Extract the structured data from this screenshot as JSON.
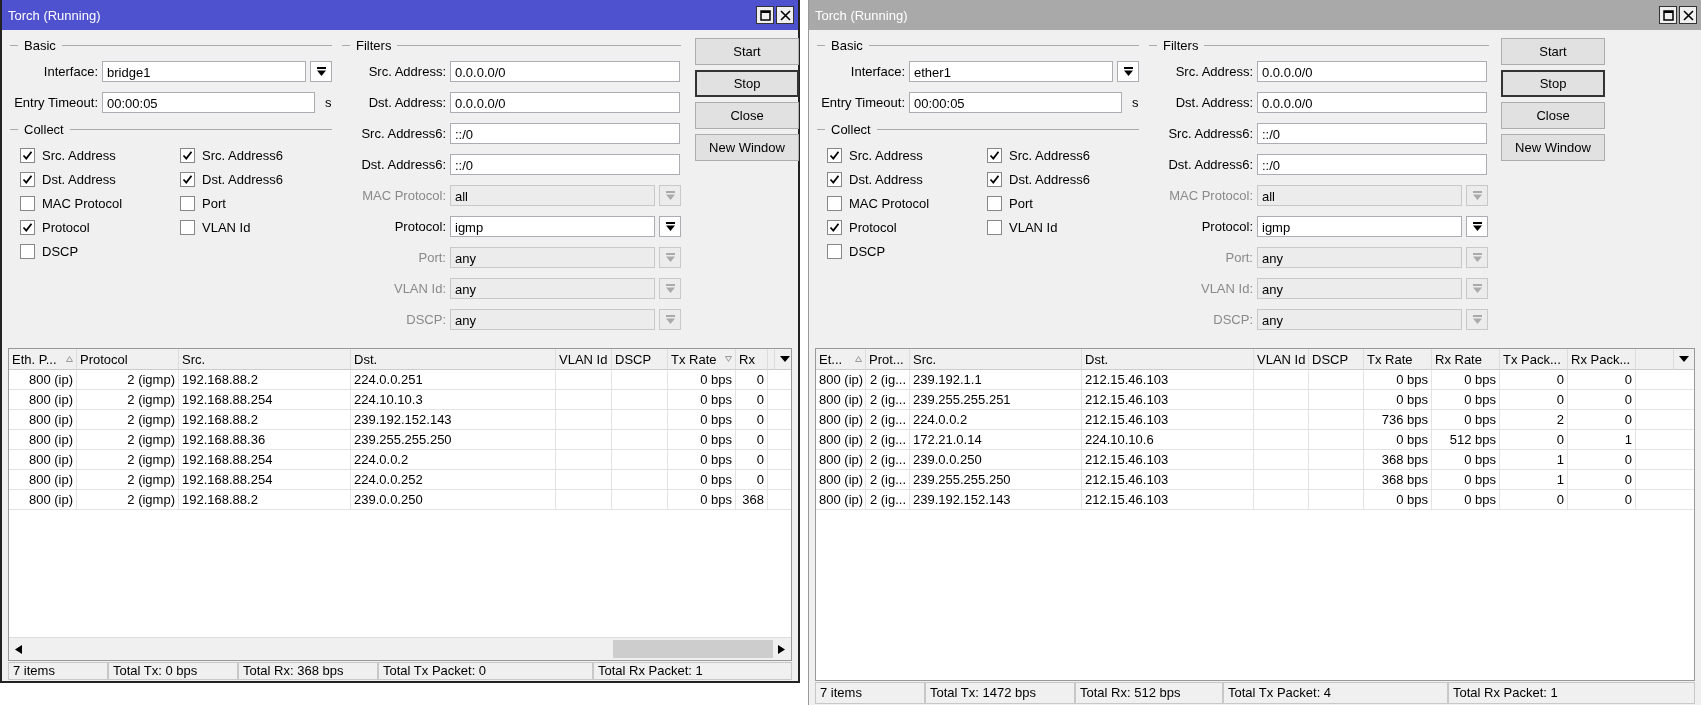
{
  "windows": [
    {
      "title": "Torch (Running)",
      "active": true,
      "horizontal_scrollbar": true,
      "basic": {
        "label": "Basic",
        "interface": {
          "label": "Interface:",
          "value": "bridge1"
        },
        "entry_timeout": {
          "label": "Entry Timeout:",
          "value": "00:00:05",
          "unit": "s"
        }
      },
      "collect": {
        "label": "Collect",
        "items": [
          {
            "label": "Src. Address",
            "checked": true
          },
          {
            "label": "Src. Address6",
            "checked": true
          },
          {
            "label": "Dst. Address",
            "checked": true
          },
          {
            "label": "Dst. Address6",
            "checked": true
          },
          {
            "label": "MAC Protocol",
            "checked": false
          },
          {
            "label": "Port",
            "checked": false
          },
          {
            "label": "Protocol",
            "checked": true
          },
          {
            "label": "VLAN Id",
            "checked": false
          },
          {
            "label": "DSCP",
            "checked": false
          }
        ]
      },
      "filters": {
        "label": "Filters",
        "fields": [
          {
            "label": "Src. Address:",
            "value": "0.0.0.0/0",
            "kind": "text",
            "disabled": false
          },
          {
            "label": "Dst. Address:",
            "value": "0.0.0.0/0",
            "kind": "text",
            "disabled": false
          },
          {
            "label": "Src. Address6:",
            "value": "::/0",
            "kind": "text",
            "disabled": false
          },
          {
            "label": "Dst. Address6:",
            "value": "::/0",
            "kind": "text",
            "disabled": false
          },
          {
            "label": "MAC Protocol:",
            "value": "all",
            "kind": "select",
            "disabled": true
          },
          {
            "label": "Protocol:",
            "value": "igmp",
            "kind": "select",
            "disabled": false
          },
          {
            "label": "Port:",
            "value": "any",
            "kind": "select",
            "disabled": true
          },
          {
            "label": "VLAN Id:",
            "value": "any",
            "kind": "select",
            "disabled": true
          },
          {
            "label": "DSCP:",
            "value": "any",
            "kind": "select",
            "disabled": true
          }
        ]
      },
      "buttons": [
        {
          "label": "Start",
          "focused": false
        },
        {
          "label": "Stop",
          "focused": true
        },
        {
          "label": "Close",
          "focused": false
        },
        {
          "label": "New Window",
          "focused": false
        }
      ],
      "table": {
        "columns": [
          {
            "label": "Eth. P...",
            "sort_ascending": true,
            "sort_descending": false
          },
          {
            "label": "Protocol",
            "sort_ascending": false,
            "sort_descending": false
          },
          {
            "label": "Src.",
            "sort_ascending": false,
            "sort_descending": false
          },
          {
            "label": "Dst.",
            "sort_ascending": false,
            "sort_descending": false
          },
          {
            "label": "VLAN Id",
            "sort_ascending": false,
            "sort_descending": false
          },
          {
            "label": "DSCP",
            "sort_ascending": false,
            "sort_descending": false
          },
          {
            "label": "Tx Rate",
            "sort_ascending": false,
            "sort_descending": true
          },
          {
            "label": "Rx",
            "sort_ascending": false,
            "sort_descending": false
          }
        ],
        "rows": [
          [
            "800 (ip)",
            "2 (igmp)",
            "192.168.88.2",
            "224.0.0.251",
            "",
            "",
            "0 bps",
            "0"
          ],
          [
            "800 (ip)",
            "2 (igmp)",
            "192.168.88.254",
            "224.10.10.3",
            "",
            "",
            "0 bps",
            "0"
          ],
          [
            "800 (ip)",
            "2 (igmp)",
            "192.168.88.2",
            "239.192.152.143",
            "",
            "",
            "0 bps",
            "0"
          ],
          [
            "800 (ip)",
            "2 (igmp)",
            "192.168.88.36",
            "239.255.255.250",
            "",
            "",
            "0 bps",
            "0"
          ],
          [
            "800 (ip)",
            "2 (igmp)",
            "192.168.88.254",
            "224.0.0.2",
            "",
            "",
            "0 bps",
            "0"
          ],
          [
            "800 (ip)",
            "2 (igmp)",
            "192.168.88.254",
            "224.0.0.252",
            "",
            "",
            "0 bps",
            "0"
          ],
          [
            "800 (ip)",
            "2 (igmp)",
            "192.168.88.2",
            "239.0.0.250",
            "",
            "",
            "0 bps",
            "368"
          ]
        ]
      },
      "status_bar": [
        "7 items",
        "Total Tx: 0 bps",
        "Total Rx: 368 bps",
        "Total Tx Packet: 0",
        "Total Rx Packet: 1"
      ]
    },
    {
      "title": "Torch (Running)",
      "active": false,
      "horizontal_scrollbar": false,
      "basic": {
        "label": "Basic",
        "interface": {
          "label": "Interface:",
          "value": "ether1"
        },
        "entry_timeout": {
          "label": "Entry Timeout:",
          "value": "00:00:05",
          "unit": "s"
        }
      },
      "collect": {
        "label": "Collect",
        "items": [
          {
            "label": "Src. Address",
            "checked": true
          },
          {
            "label": "Src. Address6",
            "checked": true
          },
          {
            "label": "Dst. Address",
            "checked": true
          },
          {
            "label": "Dst. Address6",
            "checked": true
          },
          {
            "label": "MAC Protocol",
            "checked": false
          },
          {
            "label": "Port",
            "checked": false
          },
          {
            "label": "Protocol",
            "checked": true
          },
          {
            "label": "VLAN Id",
            "checked": false
          },
          {
            "label": "DSCP",
            "checked": false
          }
        ]
      },
      "filters": {
        "label": "Filters",
        "fields": [
          {
            "label": "Src. Address:",
            "value": "0.0.0.0/0",
            "kind": "text",
            "disabled": false
          },
          {
            "label": "Dst. Address:",
            "value": "0.0.0.0/0",
            "kind": "text",
            "disabled": false
          },
          {
            "label": "Src. Address6:",
            "value": "::/0",
            "kind": "text",
            "disabled": false
          },
          {
            "label": "Dst. Address6:",
            "value": "::/0",
            "kind": "text",
            "disabled": false
          },
          {
            "label": "MAC Protocol:",
            "value": "all",
            "kind": "select",
            "disabled": true
          },
          {
            "label": "Protocol:",
            "value": "igmp",
            "kind": "select",
            "disabled": false
          },
          {
            "label": "Port:",
            "value": "any",
            "kind": "select",
            "disabled": true
          },
          {
            "label": "VLAN Id:",
            "value": "any",
            "kind": "select",
            "disabled": true
          },
          {
            "label": "DSCP:",
            "value": "any",
            "kind": "select",
            "disabled": true
          }
        ]
      },
      "buttons": [
        {
          "label": "Start",
          "focused": false
        },
        {
          "label": "Stop",
          "focused": true
        },
        {
          "label": "Close",
          "focused": false
        },
        {
          "label": "New Window",
          "focused": false
        }
      ],
      "table": {
        "columns": [
          {
            "label": "Et...",
            "sort_ascending": true,
            "sort_descending": false
          },
          {
            "label": "Prot...",
            "sort_ascending": false,
            "sort_descending": false
          },
          {
            "label": "Src.",
            "sort_ascending": false,
            "sort_descending": false
          },
          {
            "label": "Dst.",
            "sort_ascending": false,
            "sort_descending": false
          },
          {
            "label": "VLAN Id",
            "sort_ascending": false,
            "sort_descending": false
          },
          {
            "label": "DSCP",
            "sort_ascending": false,
            "sort_descending": false
          },
          {
            "label": "Tx Rate",
            "sort_ascending": false,
            "sort_descending": false
          },
          {
            "label": "Rx Rate",
            "sort_ascending": false,
            "sort_descending": false
          },
          {
            "label": "Tx Pack...",
            "sort_ascending": false,
            "sort_descending": false
          },
          {
            "label": "Rx Pack...",
            "sort_ascending": false,
            "sort_descending": false
          }
        ],
        "rows": [
          [
            "800 (ip)",
            "2 (ig...",
            "239.192.1.1",
            "212.15.46.103",
            "",
            "",
            "0 bps",
            "0 bps",
            "0",
            "0"
          ],
          [
            "800 (ip)",
            "2 (ig...",
            "239.255.255.251",
            "212.15.46.103",
            "",
            "",
            "0 bps",
            "0 bps",
            "0",
            "0"
          ],
          [
            "800 (ip)",
            "2 (ig...",
            "224.0.0.2",
            "212.15.46.103",
            "",
            "",
            "736 bps",
            "0 bps",
            "2",
            "0"
          ],
          [
            "800 (ip)",
            "2 (ig...",
            "172.21.0.14",
            "224.10.10.6",
            "",
            "",
            "0 bps",
            "512 bps",
            "0",
            "1"
          ],
          [
            "800 (ip)",
            "2 (ig...",
            "239.0.0.250",
            "212.15.46.103",
            "",
            "",
            "368 bps",
            "0 bps",
            "1",
            "0"
          ],
          [
            "800 (ip)",
            "2 (ig...",
            "239.255.255.250",
            "212.15.46.103",
            "",
            "",
            "368 bps",
            "0 bps",
            "1",
            "0"
          ],
          [
            "800 (ip)",
            "2 (ig...",
            "239.192.152.143",
            "212.15.46.103",
            "",
            "",
            "0 bps",
            "0 bps",
            "0",
            "0"
          ]
        ]
      },
      "status_bar": [
        "7 items",
        "Total Tx: 1472 bps",
        "Total Rx: 512 bps",
        "Total Tx Packet: 4",
        "Total Rx Packet: 1"
      ]
    }
  ]
}
